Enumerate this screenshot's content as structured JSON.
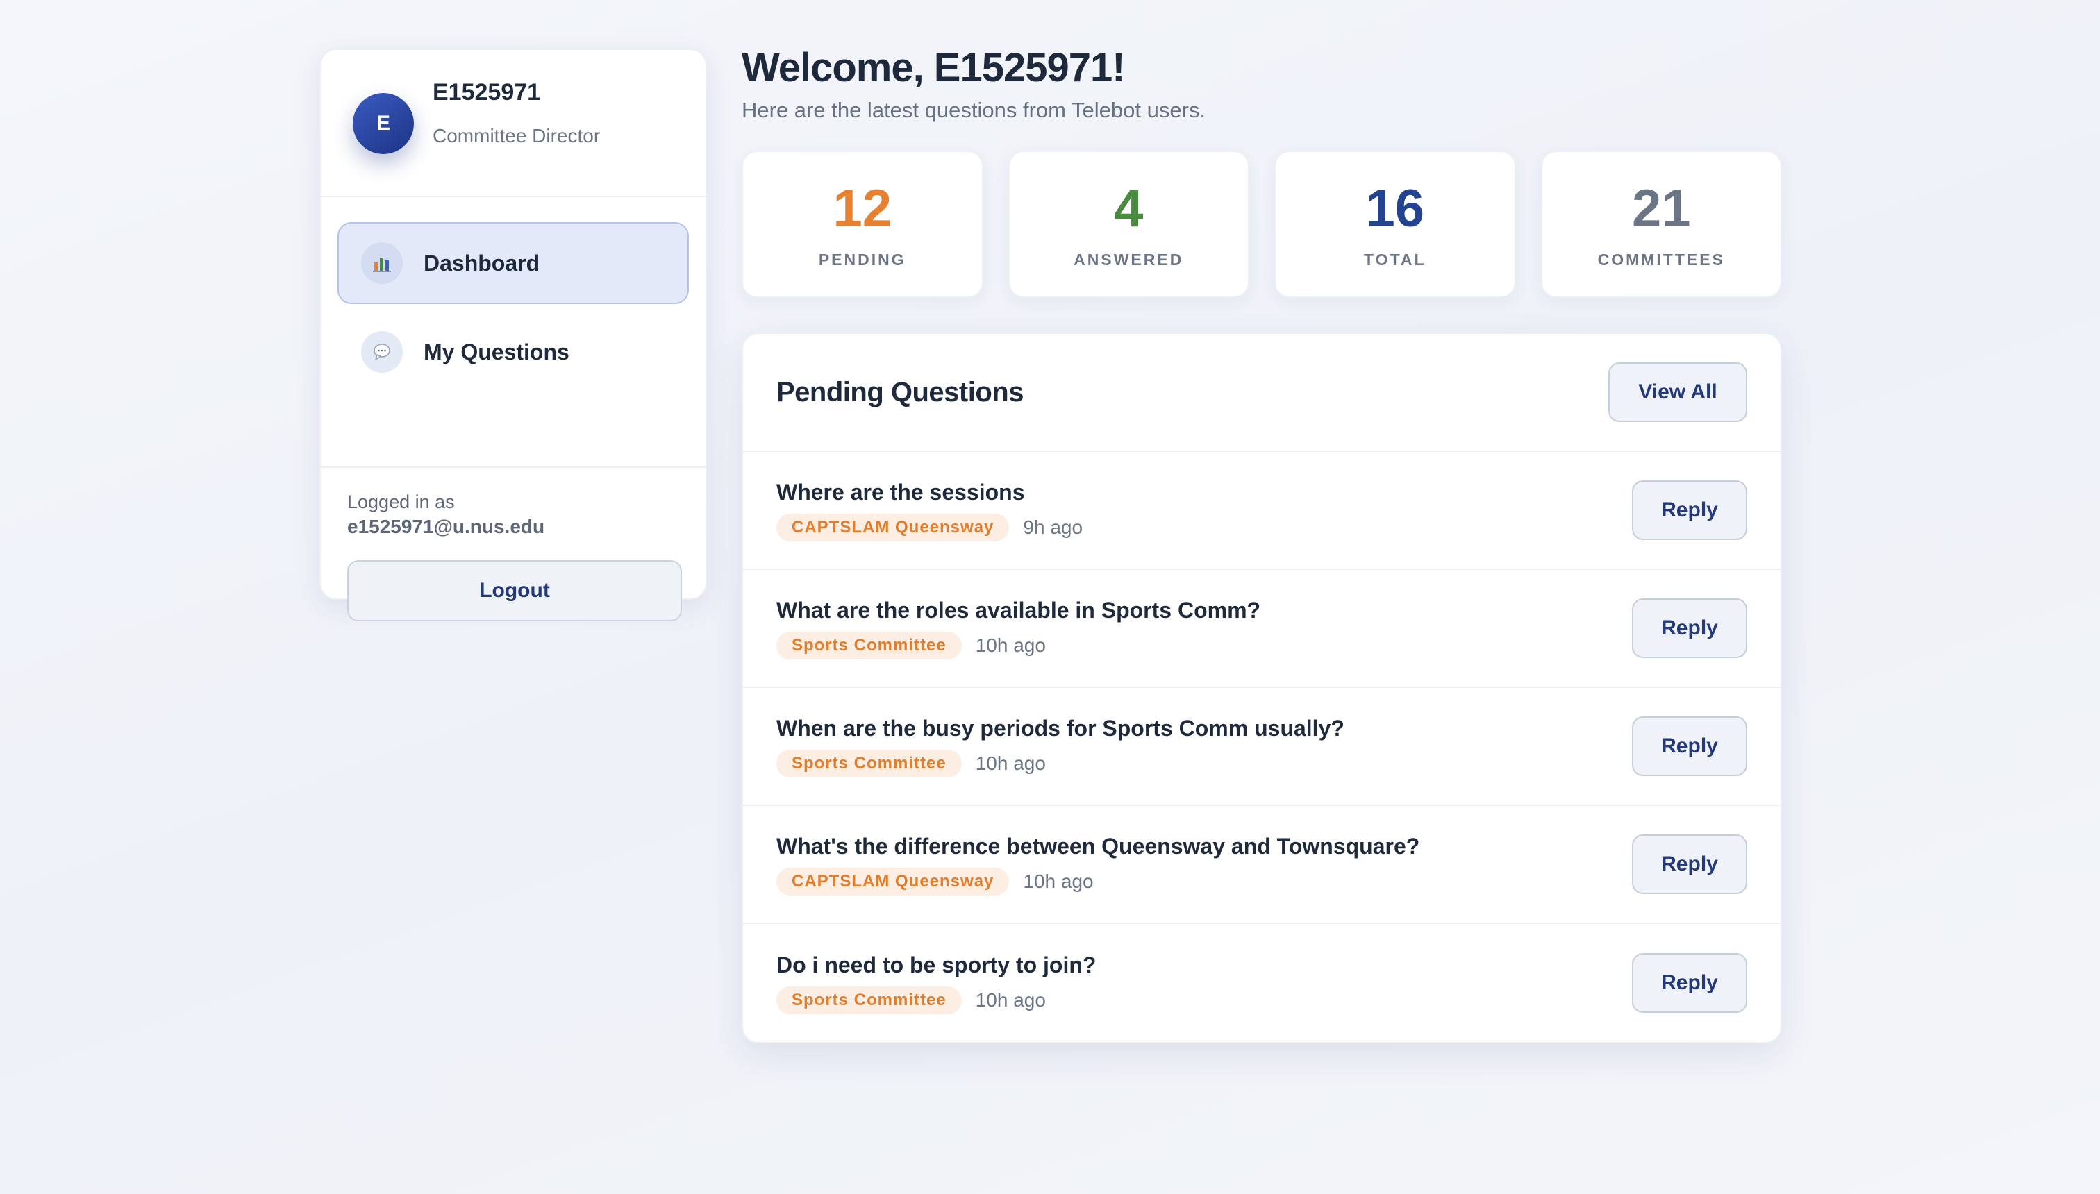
{
  "profile": {
    "avatar_initial": "E",
    "name": "E1525971",
    "role": "Committee Director"
  },
  "nav": [
    {
      "label": "Dashboard",
      "icon": "bar-chart-icon",
      "active": true
    },
    {
      "label": "My Questions",
      "icon": "speech-bubble-icon",
      "active": false
    }
  ],
  "account": {
    "logged_in_label": "Logged in as",
    "email": "e1525971@u.nus.edu",
    "logout_label": "Logout"
  },
  "header": {
    "welcome": "Welcome, E1525971!",
    "subtitle": "Here are the latest questions from Telebot users."
  },
  "stats": [
    {
      "value": "12",
      "label": "PENDING",
      "color": "#e8812f"
    },
    {
      "value": "4",
      "label": "ANSWERED",
      "color": "#4a8c3f"
    },
    {
      "value": "16",
      "label": "TOTAL",
      "color": "#23428f"
    },
    {
      "value": "21",
      "label": "COMMITTEES",
      "color": "#6b7585"
    }
  ],
  "pending": {
    "title": "Pending Questions",
    "view_all_label": "View All",
    "reply_label": "Reply",
    "questions": [
      {
        "text": "Where are the sessions",
        "committee": "CAPTSLAM Queensway",
        "time": "9h ago"
      },
      {
        "text": "What are the roles available in Sports Comm?",
        "committee": "Sports Committee",
        "time": "10h ago"
      },
      {
        "text": "When are the busy periods for Sports Comm usually?",
        "committee": "Sports Committee",
        "time": "10h ago"
      },
      {
        "text": "What's the difference between Queensway and Townsquare?",
        "committee": "CAPTSLAM Queensway",
        "time": "10h ago"
      },
      {
        "text": "Do i need to be sporty to join?",
        "committee": "Sports Committee",
        "time": "10h ago"
      }
    ]
  },
  "colors": {
    "accent": "#23397a",
    "badge_bg": "#fdeee3",
    "badge_text": "#e27d2c",
    "active_nav_bg": "#e3e9f8"
  }
}
